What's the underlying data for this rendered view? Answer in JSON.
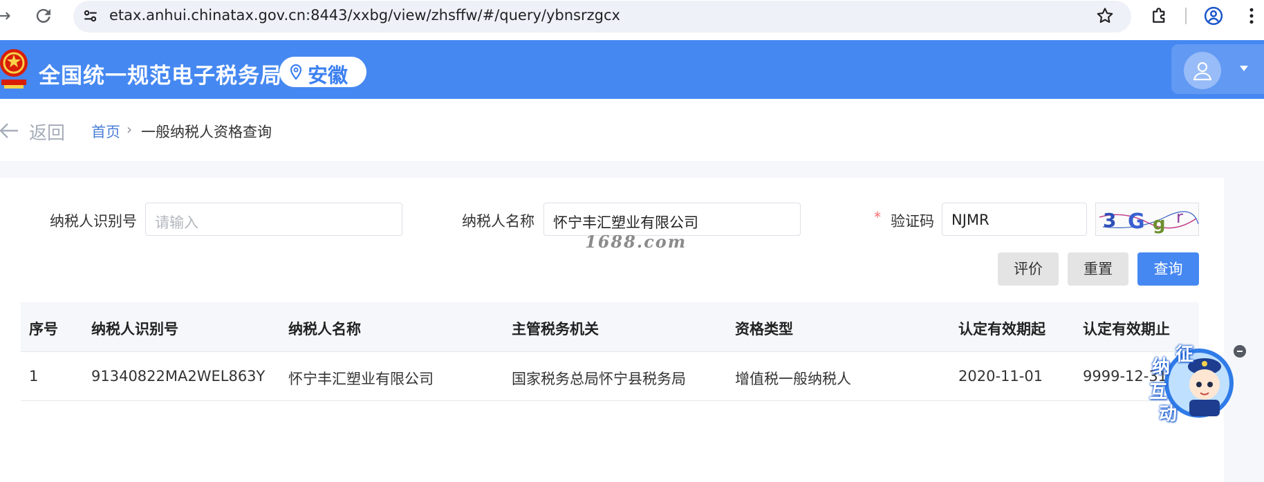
{
  "browser": {
    "url": "etax.anhui.chinatax.gov.cn:8443/xxbg/view/zhsffw/#/query/ybnsrzgcx"
  },
  "header": {
    "title": "全国统一规范电子税务局",
    "region": "安徽",
    "bg_color": "#4688f1"
  },
  "breadcrumb": {
    "back_label": "返回",
    "home": "首页",
    "separator": "›",
    "current": "一般纳税人资格查询"
  },
  "form": {
    "taxpayer_id_label": "纳税人识别号",
    "taxpayer_id_placeholder": "请输入",
    "taxpayer_name_label": "纳税人名称",
    "taxpayer_name_value": "怀宁丰汇塑业有限公司",
    "captcha_required_mark": "*",
    "captcha_label": "验证码",
    "captcha_value": "NJMR",
    "captcha_image_text": "3Ggr",
    "watermark": "1688.com"
  },
  "buttons": {
    "rate": "评价",
    "reset": "重置",
    "query": "查询"
  },
  "table": {
    "headers": [
      "序号",
      "纳税人识别号",
      "纳税人名称",
      "主管税务机关",
      "资格类型",
      "认定有效期起",
      "认定有效期止"
    ],
    "rows": [
      [
        "1",
        "91340822MA2WEL863Y",
        "怀宁丰汇塑业有限公司",
        "国家税务总局怀宁县税务局",
        "增值税一般纳税人",
        "2020-11-01",
        "9999-12-31"
      ]
    ]
  },
  "float_widget": {
    "chars": [
      "征",
      "纳",
      "互",
      "动"
    ]
  },
  "colors": {
    "accent": "#4688f1",
    "link": "#4a7fd6",
    "required": "#f56c6c"
  }
}
